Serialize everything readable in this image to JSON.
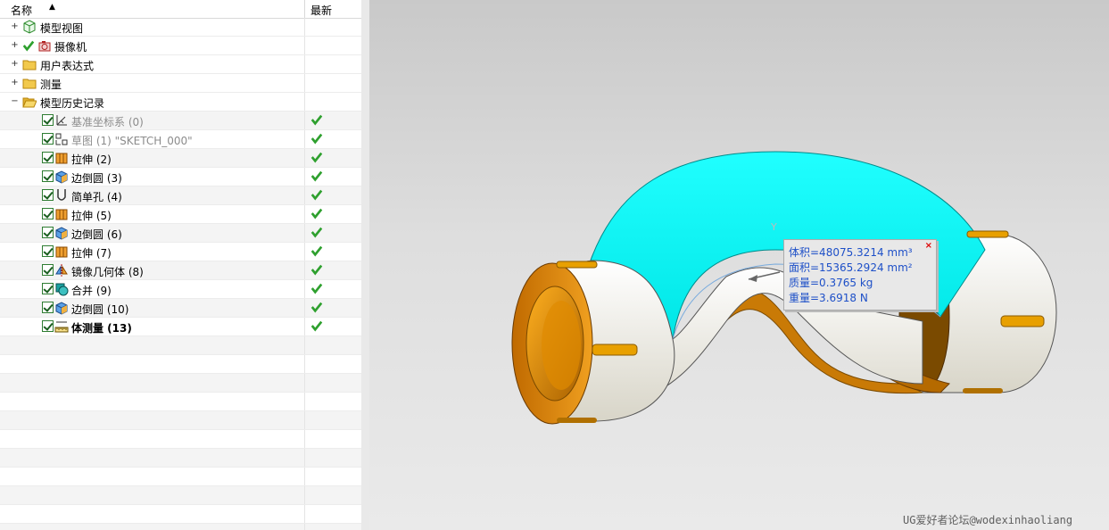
{
  "navigator": {
    "columns": {
      "name": "名称",
      "sort_indicator": "▲",
      "latest": "最新"
    },
    "top_nodes": [
      {
        "label": "模型视图",
        "icon": "model-views-icon"
      },
      {
        "label": "摄像机",
        "icon": "camera-icon"
      },
      {
        "label": "用户表达式",
        "icon": "folder-icon"
      },
      {
        "label": "测量",
        "icon": "folder-icon"
      },
      {
        "label": "模型历史记录",
        "icon": "folder-open-icon"
      }
    ],
    "history": [
      {
        "label": "基准坐标系 (0)",
        "icon": "datum-csys-icon",
        "style": "grey"
      },
      {
        "label": "草图 (1) \"SKETCH_000\"",
        "icon": "sketch-icon",
        "style": "grey"
      },
      {
        "label": "拉伸 (2)",
        "icon": "extrude-icon",
        "style": "normal"
      },
      {
        "label": "边倒圆 (3)",
        "icon": "edge-blend-icon",
        "style": "normal"
      },
      {
        "label": "简单孔 (4)",
        "icon": "hole-icon",
        "style": "normal"
      },
      {
        "label": "拉伸 (5)",
        "icon": "extrude-icon",
        "style": "normal"
      },
      {
        "label": "边倒圆 (6)",
        "icon": "edge-blend-icon",
        "style": "normal"
      },
      {
        "label": "拉伸 (7)",
        "icon": "extrude-icon",
        "style": "normal"
      },
      {
        "label": "镜像几何体 (8)",
        "icon": "mirror-geometry-icon",
        "style": "normal"
      },
      {
        "label": "合并 (9)",
        "icon": "unite-icon",
        "style": "normal"
      },
      {
        "label": "边倒圆 (10)",
        "icon": "edge-blend-icon",
        "style": "normal"
      },
      {
        "label": "体测量 (13)",
        "icon": "measure-body-icon",
        "style": "bold"
      }
    ]
  },
  "measure_tooltip": {
    "lines": [
      "体积=48075.3214 mm³",
      "面积=15365.2924 mm²",
      "质量=0.3765 kg",
      "重量=3.6918 N"
    ],
    "close": "×"
  },
  "view": {
    "axis_label": "Y"
  },
  "watermark": "UG爱好者论坛@wodexinhaoliang",
  "colors": {
    "cyan_face": "#00ffff",
    "orange_part": "#d9860c",
    "latest_check": "#2ea02e"
  }
}
